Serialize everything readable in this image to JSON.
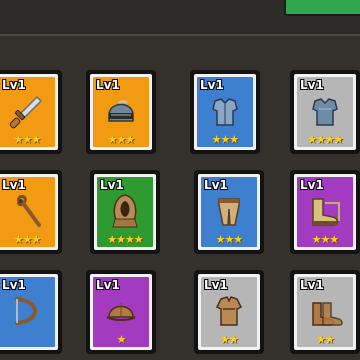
{
  "colors": {
    "orange": "#f29a12",
    "blue": "#3f7fd0",
    "gray": "#b6b6b6",
    "green": "#2f9a2f",
    "purple": "#a33bc0",
    "star": "#ffd21a",
    "accent_green": "#2fa84d"
  },
  "items": [
    {
      "level": "Lv1",
      "rarity": "orange",
      "icon": "dagger-icon",
      "stars": 3
    },
    {
      "level": "Lv1",
      "rarity": "orange",
      "icon": "helmet-icon",
      "stars": 3
    },
    {
      "level": "Lv1",
      "rarity": "blue",
      "icon": "chest-armor-icon",
      "stars": 3
    },
    {
      "level": "Lv1",
      "rarity": "gray",
      "icon": "chest-armor-icon",
      "stars": 4
    },
    {
      "level": "Lv1",
      "rarity": "orange",
      "icon": "staff-icon",
      "stars": 3
    },
    {
      "level": "Lv1",
      "rarity": "green",
      "icon": "hood-icon",
      "stars": 4
    },
    {
      "level": "Lv1",
      "rarity": "blue",
      "icon": "pants-icon",
      "stars": 3
    },
    {
      "level": "Lv1",
      "rarity": "purple",
      "icon": "boots-icon",
      "stars": 3
    },
    {
      "level": "Lv1",
      "rarity": "blue",
      "icon": "bow-icon",
      "stars": 0
    },
    {
      "level": "Lv1",
      "rarity": "purple",
      "icon": "cap-icon",
      "stars": 1
    },
    {
      "level": "Lv1",
      "rarity": "gray",
      "icon": "tunic-icon",
      "stars": 2
    },
    {
      "level": "Lv1",
      "rarity": "gray",
      "icon": "boots-icon",
      "stars": 2
    }
  ]
}
